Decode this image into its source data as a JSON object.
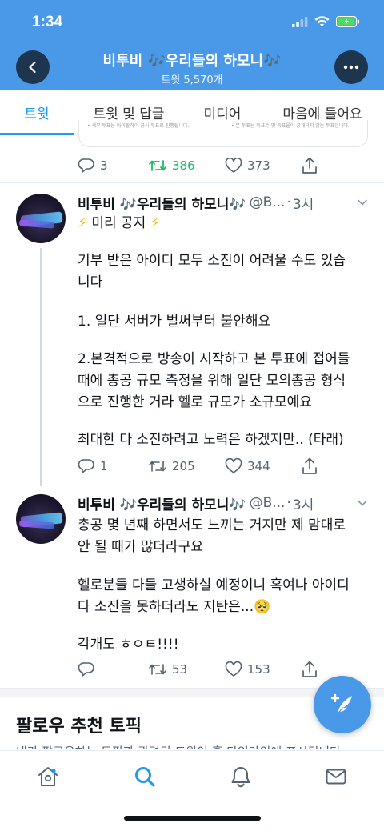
{
  "status_bar": {
    "time": "1:34"
  },
  "header": {
    "title": "비투비 🎶우리들의 하모니🎶",
    "subtitle": "트윗 5,570개"
  },
  "tabs": [
    {
      "label": "트윗",
      "active": true
    },
    {
      "label": "트윗 및 답글",
      "active": false
    },
    {
      "label": "미디어",
      "active": false
    },
    {
      "label": "마음에 들어요",
      "active": false
    }
  ],
  "prev_tweet": {
    "card_text_left": "• 세부 투표는 아이돌하이 공식 투표로 진행됩니다.",
    "card_text_right": "• 본 투표는 득표수 및 득표율이 공개되지 않는 투표입니다.",
    "replies": "3",
    "retweets": "386",
    "likes": "373"
  },
  "tweets": [
    {
      "name": "비투비 🎶우리들의 하모니🎶",
      "handle": "@B...",
      "time": "3시",
      "lines": [
        "⚡ 미리 공지 ⚡",
        "기부 받은 아이디 모두 소진이 어려울 수도 있습\n니다",
        "1. 일단 서버가 벌써부터 불안해요",
        "2.본격적으로 방송이 시작하고 본 투표에 접어들\n때에 총공 규모 측정을 위해 일단 모의총공 형식\n으로 진행한 거라 헬로 규모가 소규모예요",
        "최대한 다 소진하려고 노력은 하겠지만.. (타래)"
      ],
      "replies": "1",
      "retweets": "205",
      "likes": "344"
    },
    {
      "name": "비투비 🎶우리들의 하모니🎶",
      "handle": "@B...",
      "time": "3시",
      "lines": [
        "총공 몇 년째 하면서도 느끼는 거지만 제 맘대로\n안 될 때가 많더라구요",
        "헬로분들 다들 고생하실 예정이니 혹여나 아이디\n다 소진을 못하더라도 지탄은...🥺",
        "각개도 ㅎㅇㅌ!!!!"
      ],
      "replies": "",
      "retweets": "53",
      "likes": "153"
    }
  ],
  "recommend": {
    "title": "팔로우 추천 토픽",
    "subtitle": "내가 팔로우하는 토픽과 관련된 트윗이 홈 타임라인에 표시됩니다"
  },
  "colors": {
    "header_bg": "#4a99e9",
    "accent": "#1d9bf0",
    "retweet_green": "#17bf63"
  },
  "icons": {
    "back": "chevron-left-icon",
    "more": "more-icon",
    "reply": "reply-icon",
    "retweet": "retweet-icon",
    "like": "heart-icon",
    "share": "share-icon",
    "compose": "compose-tweet-icon",
    "nav": [
      "home-icon",
      "search-icon",
      "notifications-icon",
      "messages-icon"
    ]
  }
}
